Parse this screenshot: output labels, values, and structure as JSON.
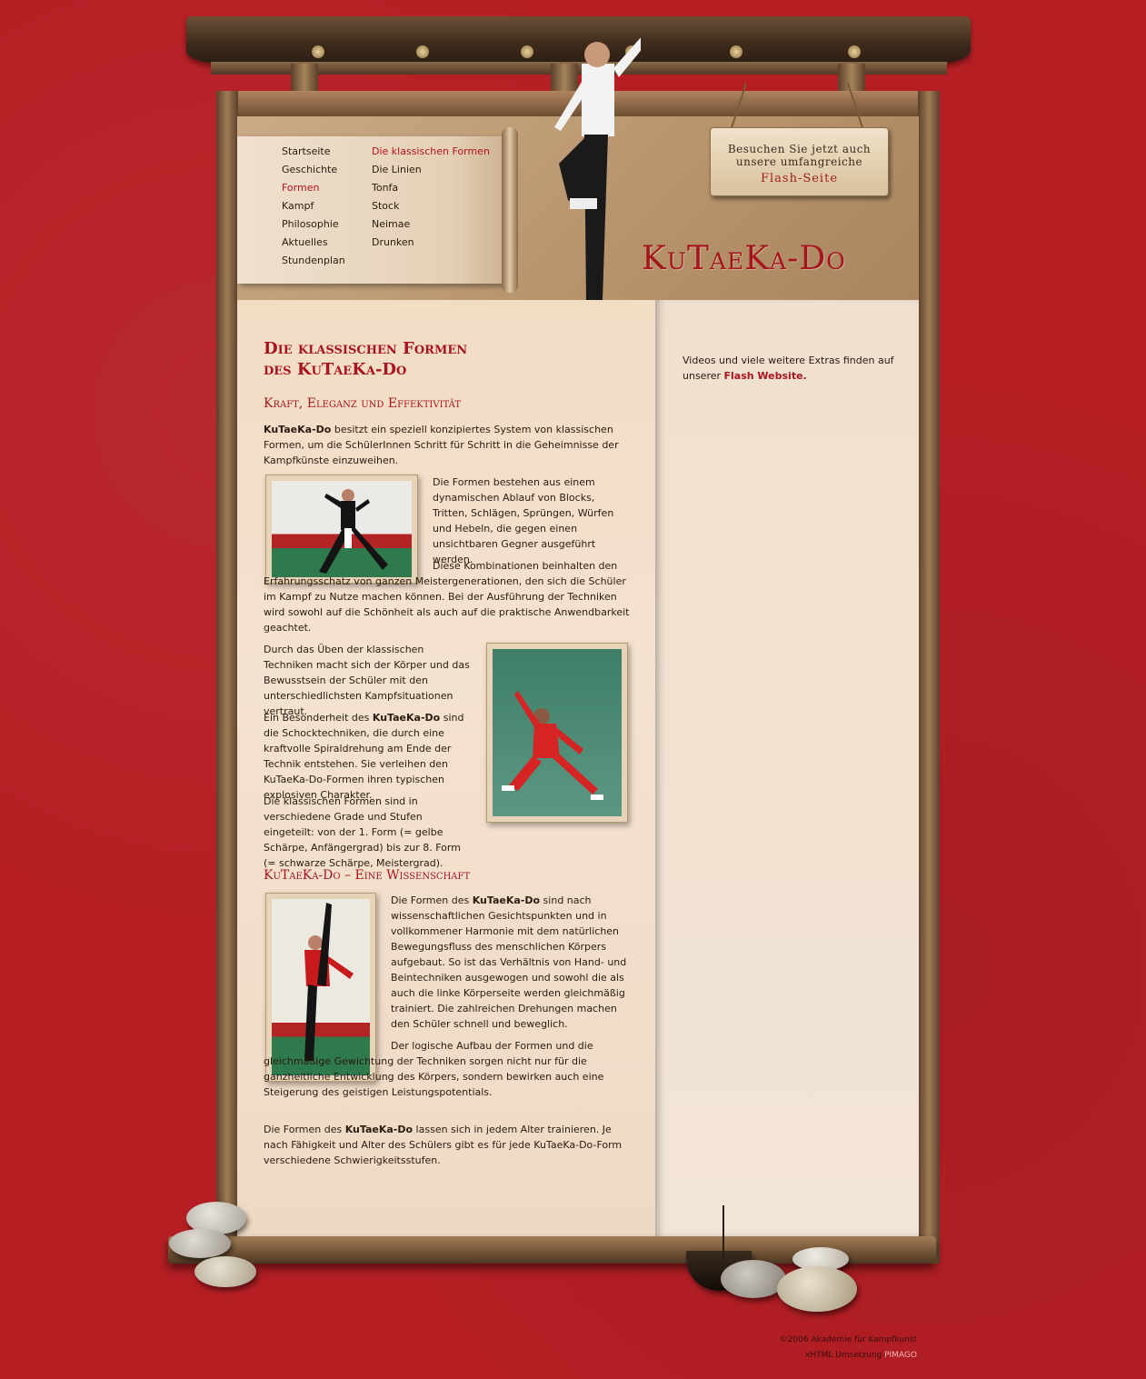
{
  "nav": {
    "left": [
      {
        "label": "Startseite",
        "active": false
      },
      {
        "label": "Geschichte",
        "active": false
      },
      {
        "label": "Formen",
        "active": true
      },
      {
        "label": "Kampf",
        "active": false
      },
      {
        "label": "Philosophie",
        "active": false
      },
      {
        "label": "Aktuelles",
        "active": false
      },
      {
        "label": "Stundenplan",
        "active": false
      }
    ],
    "right": [
      {
        "label": "Die klassischen Formen",
        "active": true
      },
      {
        "label": "Die Linien",
        "active": false
      },
      {
        "label": "Tonfa",
        "active": false
      },
      {
        "label": "Stock",
        "active": false
      },
      {
        "label": "Neimae",
        "active": false
      },
      {
        "label": "Drunken",
        "active": false
      }
    ]
  },
  "header": {
    "flash_sign_line1": "Besuchen Sie jetzt auch",
    "flash_sign_line2": "unsere umfangreiche",
    "flash_sign_link": "Flash-Seite",
    "logo": "KuTaeKa-Do"
  },
  "main": {
    "title_line1": "Die klassischen Formen",
    "title_line2": "des KuTaeKa-Do",
    "section1_heading": "Kraft, Eleganz und Effektivität",
    "p1_bold": "KuTaeKa-Do",
    "p1_rest": " besitzt ein speziell konzipiertes System von klassischen Formen, um die SchülerInnen Schritt für Schritt in die Geheimnisse der Kampfkünste einzuweihen.",
    "p2": "Die Formen bestehen aus einem dynamischen Ablauf von Blocks, Tritten, Schlägen, Sprüngen, Würfen und Hebeln, die gegen einen unsichtbaren Gegner ausgeführt werden.",
    "p3": "Diese Kombinationen beinhalten den Erfahrungsschatz von ganzen Meistergenerationen, den sich die Schüler im Kampf zu Nutze machen können. Bei der Ausführung der Techniken wird sowohl auf die Schönheit als auch auf die praktische Anwendbarkeit geachtet.",
    "p4": "Durch das Üben der klassischen Techniken macht sich der Körper und das Bewusstsein der Schüler mit den unterschiedlichsten Kampfsituationen vertraut.",
    "p5_a": "Ein Besonderheit des ",
    "p5_bold": "KuTaeKa-Do",
    "p5_b": " sind die Schocktechniken, die durch eine kraftvolle Spiraldrehung am Ende der Technik entstehen. Sie verleihen den KuTaeKa-Do-Formen ihren typischen explosiven Charakter.",
    "p6": "Die klassischen Formen sind in verschiedene Grade und Stufen eingeteilt: von der 1. Form (= gelbe Schärpe, Anfängergrad) bis zur 8. Form (= schwarze Schärpe, Meistergrad).",
    "section2_heading": "KuTaeKa-Do – Eine Wissenschaft",
    "p7_a": "Die Formen des ",
    "p7_bold": "KuTaeKa-Do",
    "p7_b": " sind nach wissenschaftlichen Gesichtspunkten und in vollkommener Harmonie mit dem natürlichen Bewegungsfluss des menschlichen Körpers aufgebaut. So ist das Verhältnis von Hand- und Beintechniken ausgewogen und sowohl die als auch die linke Körperseite werden gleichmäßig trainiert. Die zahlreichen Drehungen machen den Schüler schnell und beweglich.",
    "p8": "Der logische Aufbau der Formen und die gleichmäßige Gewichtung der Techniken sorgen nicht nur für die ganzheitliche Entwicklung des Körpers, sondern bewirken auch eine Steigerung des geistigen Leistungspotentials.",
    "p9_a": "Die Formen des ",
    "p9_bold": "KuTaeKa-Do",
    "p9_b": " lassen sich in jedem Alter trainieren. Je nach Fähigkeit und Alter des Schülers gibt es für jede KuTaeKa-Do-Form verschiedene Schwierigkeitsstufen."
  },
  "sidebar": {
    "text": "Videos und viele weitere Extras finden auf unserer ",
    "link": "Flash Website."
  },
  "footer": {
    "line1": "©2006 Akademie für Kampfkunst",
    "line2_text": "xHTML Umsetzung ",
    "line2_link": "PIMAGO"
  },
  "colors": {
    "background": "#b51f24",
    "accent": "#a8141d"
  }
}
